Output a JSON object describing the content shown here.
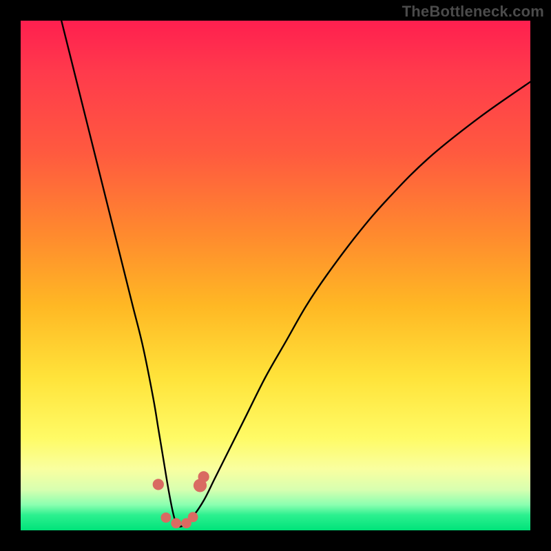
{
  "watermark": "TheBottleneck.com",
  "chart_data": {
    "type": "line",
    "title": "",
    "xlabel": "",
    "ylabel": "",
    "xlim": [
      0,
      100
    ],
    "ylim": [
      0,
      100
    ],
    "grid": false,
    "legend": false,
    "series": [
      {
        "name": "curve",
        "color": "#000000",
        "x": [
          8,
          10,
          12,
          14,
          16,
          18,
          20,
          22,
          24,
          26,
          27,
          28,
          29,
          30,
          30.8,
          32,
          34,
          36,
          38,
          40,
          44,
          48,
          52,
          56,
          60,
          66,
          72,
          80,
          90,
          100
        ],
        "y": [
          100,
          92,
          84,
          76,
          68,
          60,
          52,
          44,
          36,
          26,
          20,
          14,
          8,
          3,
          1,
          1,
          3,
          6,
          10,
          14,
          22,
          30,
          37,
          44,
          50,
          58,
          65,
          73,
          81,
          88
        ]
      }
    ],
    "markers": [
      {
        "name": "left-marker",
        "x": 27.0,
        "y": 9.0,
        "r": 1.1,
        "color": "#d96b62"
      },
      {
        "name": "dip-marker-1",
        "x": 28.5,
        "y": 2.5,
        "r": 1.0,
        "color": "#d96b62"
      },
      {
        "name": "dip-marker-2",
        "x": 30.5,
        "y": 1.4,
        "r": 1.0,
        "color": "#d96b62"
      },
      {
        "name": "dip-marker-3",
        "x": 32.5,
        "y": 1.4,
        "r": 1.0,
        "color": "#d96b62"
      },
      {
        "name": "dip-marker-4",
        "x": 33.8,
        "y": 2.6,
        "r": 1.0,
        "color": "#d96b62"
      },
      {
        "name": "right-marker-1",
        "x": 35.2,
        "y": 8.8,
        "r": 1.3,
        "color": "#d96b62"
      },
      {
        "name": "right-marker-2",
        "x": 35.9,
        "y": 10.5,
        "r": 1.1,
        "color": "#d96b62"
      }
    ],
    "gradient_stops": [
      {
        "pos": 0,
        "color": "#ff1f4f"
      },
      {
        "pos": 10,
        "color": "#ff3a4c"
      },
      {
        "pos": 26,
        "color": "#ff5a3f"
      },
      {
        "pos": 42,
        "color": "#ff8a2e"
      },
      {
        "pos": 56,
        "color": "#ffb824"
      },
      {
        "pos": 70,
        "color": "#ffe33a"
      },
      {
        "pos": 82,
        "color": "#fffb66"
      },
      {
        "pos": 88,
        "color": "#f9ffa0"
      },
      {
        "pos": 92,
        "color": "#d8ffb0"
      },
      {
        "pos": 95,
        "color": "#8affb0"
      },
      {
        "pos": 97,
        "color": "#2cf08f"
      },
      {
        "pos": 100,
        "color": "#00e37a"
      }
    ]
  }
}
